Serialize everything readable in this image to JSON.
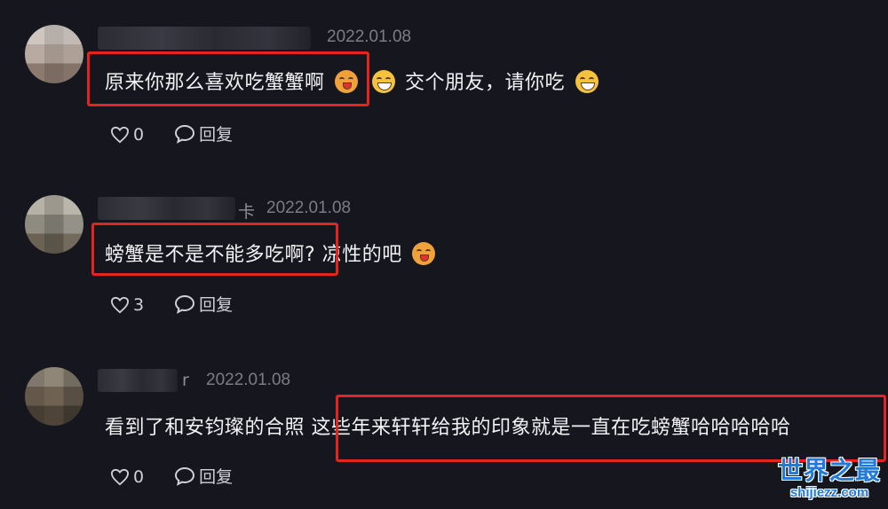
{
  "comments": [
    {
      "name_suffix": "",
      "date": "2022.01.08",
      "highlighted_text": "原来你那么喜欢吃蟹蟹啊",
      "text_after": "交个朋友，请你吃",
      "likes": "0",
      "reply_label": "回复"
    },
    {
      "name_suffix": "卡",
      "date": "2022.01.08",
      "highlighted_text": "螃蟹是不是不能多吃啊?",
      "text_after": "凉性的吧",
      "likes": "3",
      "reply_label": "回复"
    },
    {
      "name_suffix": "r",
      "date": "2022.01.08",
      "text_before": "看到了和安钧璨的合照",
      "highlighted_text": "这些年来轩轩给我的印象就是一直在吃螃蟹哈哈哈哈哈",
      "likes": "0",
      "reply_label": "回复"
    }
  ],
  "watermark": {
    "cn": "世界之最",
    "en": "shijiezz.com"
  },
  "colors": {
    "background": "#16161e",
    "highlight": "#e5231f",
    "watermark": "#1f7ad8"
  },
  "icons": [
    "heart-icon",
    "comment-bubble-icon",
    "grin-emoji",
    "blush-emoji"
  ]
}
